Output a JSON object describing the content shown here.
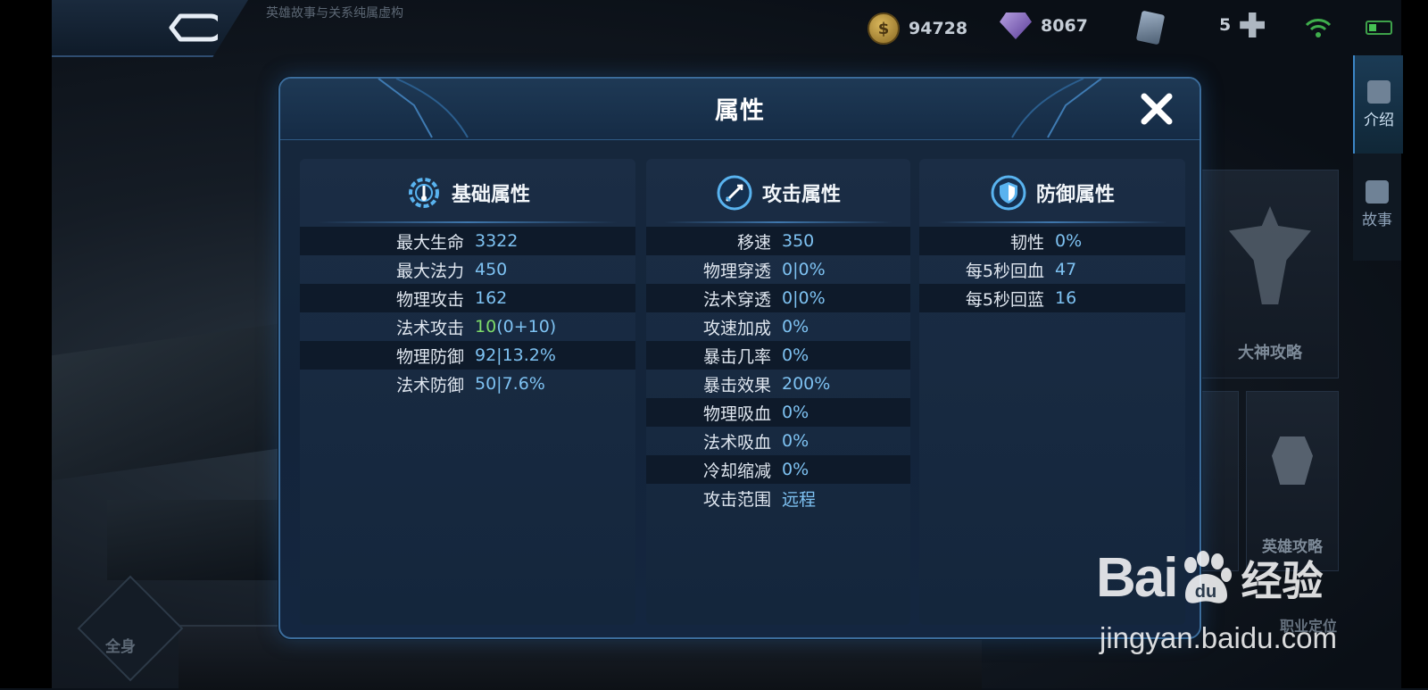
{
  "topbar": {
    "hero_note": "英雄故事与关系纯属虚构",
    "gold": "94728",
    "diamonds": "8067",
    "card_count": "5"
  },
  "side_tabs": [
    {
      "label": "介绍"
    },
    {
      "label": "故事"
    }
  ],
  "cards": {
    "big_label": "大神攻略",
    "hero_guide_label": "英雄攻略",
    "role_label": "职业定位"
  },
  "skin_label": "全身",
  "panel": {
    "title": "属性",
    "columns": [
      {
        "title": "基础属性",
        "icon": "gear-icon",
        "rows": [
          {
            "label": "最大生命",
            "value": "3322"
          },
          {
            "label": "最大法力",
            "value": "450"
          },
          {
            "label": "物理攻击",
            "value": "162"
          },
          {
            "label": "法术攻击",
            "value_base": "10",
            "value_extra": "(0+10)"
          },
          {
            "label": "物理防御",
            "value": "92|13.2%"
          },
          {
            "label": "法术防御",
            "value": "50|7.6%"
          }
        ]
      },
      {
        "title": "攻击属性",
        "icon": "sword-icon",
        "rows": [
          {
            "label": "移速",
            "value": "350"
          },
          {
            "label": "物理穿透",
            "value": "0|0%"
          },
          {
            "label": "法术穿透",
            "value": "0|0%"
          },
          {
            "label": "攻速加成",
            "value": "0%"
          },
          {
            "label": "暴击几率",
            "value": "0%"
          },
          {
            "label": "暴击效果",
            "value": "200%"
          },
          {
            "label": "物理吸血",
            "value": "0%"
          },
          {
            "label": "法术吸血",
            "value": "0%"
          },
          {
            "label": "冷却缩减",
            "value": "0%"
          },
          {
            "label": "攻击范围",
            "value": "远程"
          }
        ]
      },
      {
        "title": "防御属性",
        "icon": "shield-icon",
        "rows": [
          {
            "label": "韧性",
            "value": "0%"
          },
          {
            "label": "每5秒回血",
            "value": "47"
          },
          {
            "label": "每5秒回蓝",
            "value": "16"
          }
        ]
      }
    ]
  },
  "watermark": {
    "brand_prefix": "Bai",
    "brand_paw": "du",
    "brand_suffix": "经验",
    "url": "jingyan.baidu.com"
  },
  "colors": {
    "value_blue": "#7ec2f2",
    "bonus_green": "#7edc6a",
    "panel_border": "#3c6d9c"
  }
}
